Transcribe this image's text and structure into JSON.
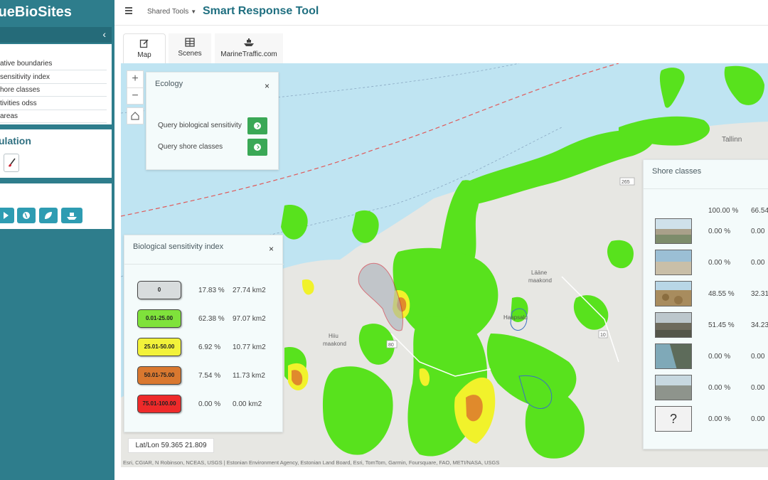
{
  "app": {
    "logo_text": "lueBioSites",
    "tool_title": "Smart Response Tool",
    "shared_tools_label": "Shared Tools"
  },
  "sidebar": {
    "collapse_glyph": "‹",
    "layers": [
      "ative boundaries",
      " sensitivity index",
      "hore classes",
      "tivities odss",
      "areas"
    ],
    "simulation_title": "ulation",
    "tool_icons": [
      "play-icon",
      "globe-icon",
      "leaf-icon",
      "ship-icon"
    ]
  },
  "tabs": [
    {
      "label": "Map",
      "icon": "edit-icon"
    },
    {
      "label": "Scenes",
      "icon": "table-icon"
    },
    {
      "label": "MarineTraffic.com",
      "icon": "ship-icon"
    }
  ],
  "map": {
    "zoom_in": "+",
    "zoom_out": "−",
    "place_labels": [
      {
        "text": "Tallinn"
      },
      {
        "text": "Lääne"
      },
      {
        "text": "maakond"
      },
      {
        "text": "Hiiu"
      },
      {
        "text": "maakond"
      },
      {
        "text": "Haapsalu"
      },
      {
        "text": "265"
      },
      {
        "text": "80"
      },
      {
        "text": "10"
      }
    ],
    "latlon": "Lat/Lon 59.365 21.809",
    "attribution": "Esri, CGIAR, N Robinson, NCEAS, USGS | Estonian Environment Agency, Estonian Land Board, Esri, TomTom, Garmin, Foursquare, FAO, METI/NASA, USGS",
    "colors": {
      "water": "#bfe4f2",
      "land": "#e7e7e3",
      "green": "#58e21d",
      "yellow": "#f1f22b",
      "orange": "#e08a2c",
      "red": "#f22",
      "teal": "#2e7d8c"
    }
  },
  "ecology": {
    "title": "Ecology",
    "close": "×",
    "queries": [
      "Query biological sensitivity",
      "Query shore classes"
    ]
  },
  "bio_sensitivity": {
    "title": "Biological sensitivity index",
    "close": "×",
    "rows": [
      {
        "label": "0",
        "percent": "17.83 %",
        "area": "27.74 km2",
        "color": "#d8dcdd"
      },
      {
        "label": "0.01-25.00",
        "percent": "62.38 %",
        "area": "97.07 km2",
        "color": "#7fe23b"
      },
      {
        "label": "25.01-50.00",
        "percent": "6.92 %",
        "area": "10.77 km2",
        "color": "#f2f23a"
      },
      {
        "label": "50.01-75.00",
        "percent": "7.54 %",
        "area": "11.73 km2",
        "color": "#d9782f"
      },
      {
        "label": "75.01-100.00",
        "percent": "0.00 %",
        "area": "0.00 km2",
        "color": "#ee2a2a"
      }
    ]
  },
  "shore_classes": {
    "title": "Shore classes",
    "total_percent": "100.00 %",
    "total_area": "66.54",
    "rows": [
      {
        "percent": "0.00 %",
        "area": "0.00"
      },
      {
        "percent": "0.00 %",
        "area": "0.00"
      },
      {
        "percent": "48.55 %",
        "area": "32.31"
      },
      {
        "percent": "51.45 %",
        "area": "34.23"
      },
      {
        "percent": "0.00 %",
        "area": "0.00"
      },
      {
        "percent": "0.00 %",
        "area": "0.00"
      },
      {
        "percent": "0.00 %",
        "area": "0.00",
        "thumb_text": "?"
      }
    ]
  }
}
